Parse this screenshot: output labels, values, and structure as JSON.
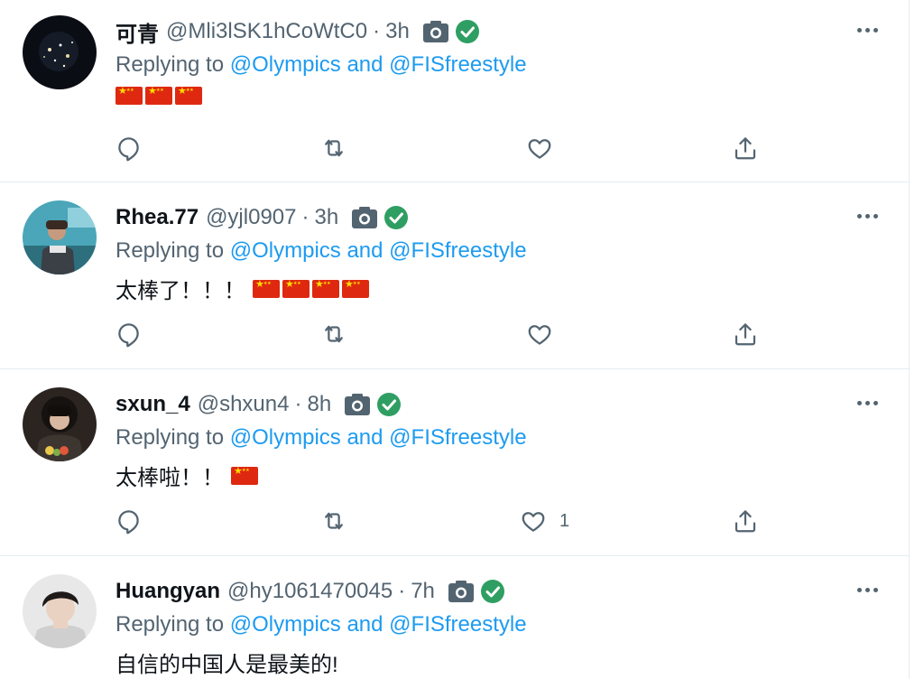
{
  "tweets": [
    {
      "name": "可青",
      "handle": "@Mli3lSK1hCoWtC0",
      "time": "3h",
      "replying_prefix": "Replying to",
      "replying_to": "@Olympics and @FISfreestyle",
      "text": "",
      "flag_count": 3,
      "like_count": "",
      "avatar_style": "night-sky"
    },
    {
      "name": "Rhea.77",
      "handle": "@yjl0907",
      "time": "3h",
      "replying_prefix": "Replying to",
      "replying_to": "@Olympics and @FISfreestyle",
      "text": "太棒了！！！",
      "flag_count": 4,
      "like_count": "",
      "avatar_style": "person-teal"
    },
    {
      "name": "sxun_4",
      "handle": "@shxun4",
      "time": "8h",
      "replying_prefix": "Replying to",
      "replying_to": "@Olympics and @FISfreestyle",
      "text": "太棒啦！！",
      "flag_count": 1,
      "like_count": "1",
      "avatar_style": "person-dark"
    },
    {
      "name": "Huangyan",
      "handle": "@hy1061470045",
      "time": "7h",
      "replying_prefix": "Replying to",
      "replying_to": "@Olympics and @FISfreestyle",
      "text": "自信的中国人是最美的!",
      "flag_count": 0,
      "like_count": "",
      "avatar_style": "person-light"
    }
  ],
  "icons": {
    "reply": "reply-icon",
    "retweet": "retweet-icon",
    "like": "like-icon",
    "share": "share-icon",
    "more": "more-icon",
    "camera": "camera-icon",
    "verified": "verified-icon"
  },
  "colors": {
    "link": "#1d9bf0",
    "secondary_text": "#536471",
    "verified": "#2f9e62",
    "flag_red": "#de2910",
    "flag_yellow": "#ffde00",
    "divider": "#e6ecf0"
  }
}
